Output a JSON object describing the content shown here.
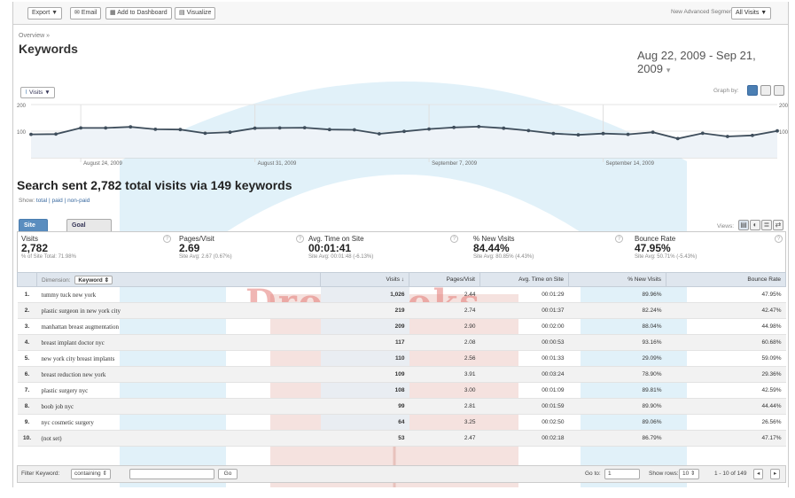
{
  "toolbar": {
    "export_label": "Export ▼",
    "email_label": "Email",
    "add_dashboard_label": "Add to Dashboard",
    "visualize_label": "Visualize",
    "segments_label": "New Advanced Segments",
    "segment_value": "All Visits ▼"
  },
  "breadcrumb": "Overview »",
  "page_title": "Keywords",
  "date_range": "Aug 22, 2009 - Sep 21, 2009",
  "graph": {
    "metric_label": "Visits ▼",
    "graph_by_label": "Graph by:",
    "y_top_left": "200",
    "y_mid_left": "100",
    "y_top_right": "200",
    "y_mid_right": "100",
    "x_labels": [
      "August 24, 2009",
      "August 31, 2009",
      "September 7, 2009",
      "September 14, 2009"
    ],
    "visits": [
      88,
      89,
      112,
      112,
      116,
      107,
      106,
      92,
      96,
      111,
      112,
      113,
      106,
      105,
      90,
      99,
      108,
      114,
      117,
      111,
      102,
      91,
      86,
      91,
      88,
      96,
      72,
      92,
      80,
      84,
      101
    ]
  },
  "summary": "Search sent 2,782 total visits via 149 keywords",
  "show_line": {
    "prefix": "Show:",
    "options": "total | paid | non-paid"
  },
  "tabs": [
    "Site Usage",
    "Goal Conversion"
  ],
  "views_label": "Views:",
  "scorecard": [
    {
      "label": "Visits",
      "value": "2,782",
      "sub": "% of Site Total: 71.98%"
    },
    {
      "label": "Pages/Visit",
      "value": "2.69",
      "sub": "Site Avg: 2.67 (0.67%)"
    },
    {
      "label": "Avg. Time on Site",
      "value": "00:01:41",
      "sub": "Site Avg: 00:01:48 (-6.13%)"
    },
    {
      "label": "% New Visits",
      "value": "84.44%",
      "sub": "Site Avg: 80.85% (4.43%)"
    },
    {
      "label": "Bounce Rate",
      "value": "47.95%",
      "sub": "Site Avg: 50.71% (-5.43%)"
    }
  ],
  "table": {
    "dimension_label": "Dimension:",
    "dimension_value": "Keyword",
    "headers": [
      "Visits ↓",
      "Pages/Visit",
      "Avg. Time on Site",
      "% New Visits",
      "Bounce Rate"
    ],
    "rows": [
      {
        "idx": "1.",
        "keyword": "tummy tuck new york",
        "visits": "1,026",
        "ppv": "2.44",
        "time": "00:01:29",
        "new": "89.96%",
        "bounce": "47.95%"
      },
      {
        "idx": "2.",
        "keyword": "plastic surgeon in new york city",
        "visits": "219",
        "ppv": "2.74",
        "time": "00:01:37",
        "new": "82.24%",
        "bounce": "42.47%"
      },
      {
        "idx": "3.",
        "keyword": "manhattan breast augmentation",
        "visits": "209",
        "ppv": "2.90",
        "time": "00:02:00",
        "new": "88.04%",
        "bounce": "44.98%"
      },
      {
        "idx": "4.",
        "keyword": "breast implant doctor nyc",
        "visits": "117",
        "ppv": "2.08",
        "time": "00:00:53",
        "new": "93.16%",
        "bounce": "60.68%"
      },
      {
        "idx": "5.",
        "keyword": "new york city breast implants",
        "visits": "110",
        "ppv": "2.56",
        "time": "00:01:33",
        "new": "29.09%",
        "bounce": "59.09%"
      },
      {
        "idx": "6.",
        "keyword": "breast reduction new york",
        "visits": "109",
        "ppv": "3.91",
        "time": "00:03:24",
        "new": "78.90%",
        "bounce": "29.36%"
      },
      {
        "idx": "7.",
        "keyword": "plastic surgery nyc",
        "visits": "108",
        "ppv": "3.00",
        "time": "00:01:09",
        "new": "89.81%",
        "bounce": "42.59%"
      },
      {
        "idx": "8.",
        "keyword": "boob job nyc",
        "visits": "99",
        "ppv": "2.81",
        "time": "00:01:59",
        "new": "89.90%",
        "bounce": "44.44%"
      },
      {
        "idx": "9.",
        "keyword": "nyc cosmetic surgery",
        "visits": "64",
        "ppv": "3.25",
        "time": "00:02:50",
        "new": "89.06%",
        "bounce": "26.56%"
      },
      {
        "idx": "10.",
        "keyword": "(not set)",
        "visits": "53",
        "ppv": "2.47",
        "time": "00:02:18",
        "new": "86.79%",
        "bounce": "47.17%"
      }
    ]
  },
  "footer": {
    "filter_label": "Filter Keyword:",
    "filter_mode": "containing",
    "go_label": "Go",
    "goto_label": "Go to:",
    "goto_value": "1",
    "show_rows_label": "Show rows:",
    "show_rows_value": "10",
    "range_label": "1 - 10 of 149"
  },
  "watermark": {
    "text": "DropBooks",
    "colors": {
      "blue": "#cfe7f5",
      "red": "#e98b86",
      "book": "#f2d8d4"
    }
  }
}
